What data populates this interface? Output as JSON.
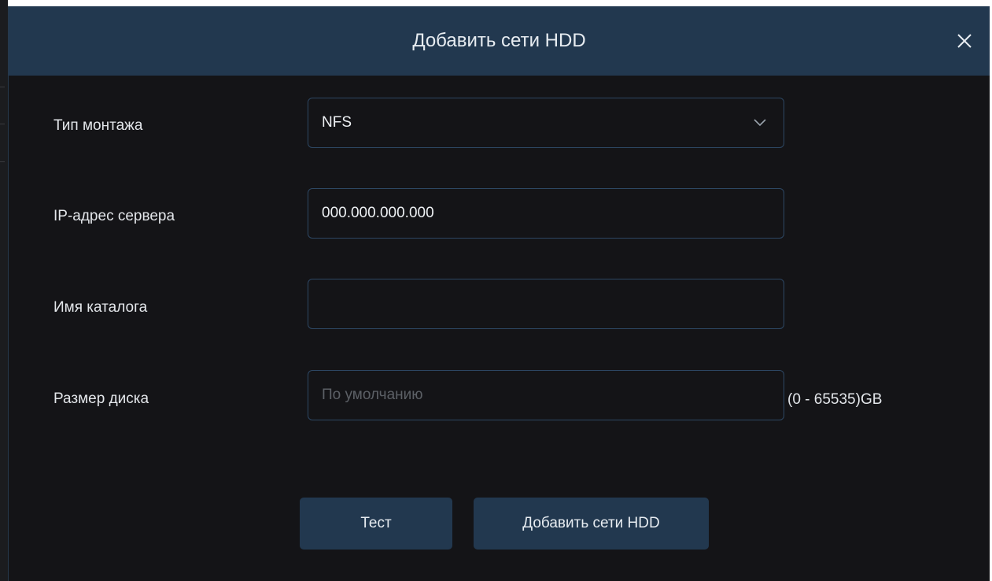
{
  "dialog": {
    "title": "Добавить сети HDD",
    "close_icon": "close-icon"
  },
  "fields": {
    "mount_type": {
      "label": "Тип монтажа",
      "value": "NFS",
      "icon": "chevron-down-icon"
    },
    "server_ip": {
      "label": "IP-адрес сервера",
      "value": "000.000.000.000"
    },
    "directory_name": {
      "label": "Имя каталога",
      "value": ""
    },
    "disk_size": {
      "label": "Размер диска",
      "value": "",
      "placeholder": "По умолчанию",
      "range_hint": "(0 - 65535)GB"
    }
  },
  "buttons": {
    "test_label": "Тест",
    "add_label": "Добавить сети HDD"
  },
  "colors": {
    "header_bg": "#22384f",
    "body_bg": "#141417",
    "field_border": "#2d4763",
    "text": "#e3e6ea"
  }
}
